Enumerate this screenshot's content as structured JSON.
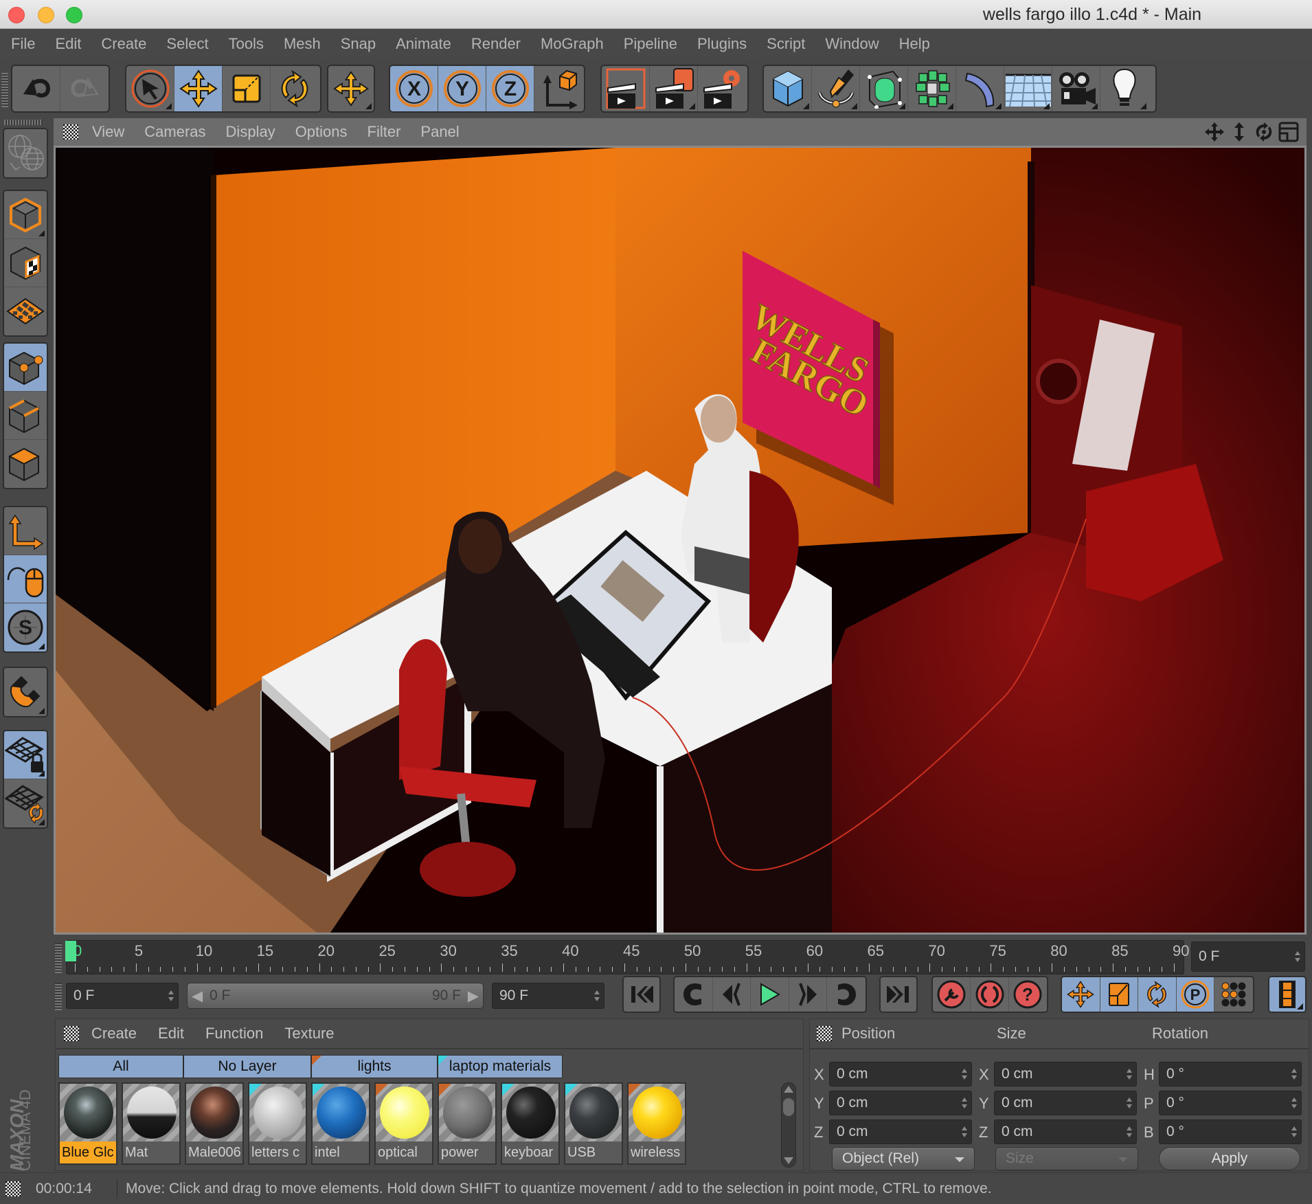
{
  "window": {
    "title": "wells fargo illo 1.c4d * - Main",
    "buttons": [
      "close",
      "minimize",
      "maximize"
    ]
  },
  "menubar": [
    "File",
    "Edit",
    "Create",
    "Select",
    "Tools",
    "Mesh",
    "Snap",
    "Animate",
    "Render",
    "MoGraph",
    "Pipeline",
    "Plugins",
    "Script",
    "Window",
    "Help"
  ],
  "toolbar": {
    "groups": [
      {
        "name": "history",
        "items": [
          {
            "icon": "undo-icon",
            "active": false
          },
          {
            "icon": "redo-icon",
            "active": false,
            "disabled": true
          }
        ]
      },
      {
        "name": "transform-tools",
        "items": [
          {
            "icon": "live-selection-icon",
            "active": false
          },
          {
            "icon": "move-icon",
            "active": true
          },
          {
            "icon": "scale-icon",
            "active": false
          },
          {
            "icon": "rotate-icon",
            "active": false
          }
        ]
      },
      {
        "name": "recent-tool",
        "items": [
          {
            "icon": "move-icon",
            "active": false
          }
        ]
      },
      {
        "name": "axis-lock",
        "items": [
          {
            "icon": "x-axis-icon",
            "label": "X",
            "active": true
          },
          {
            "icon": "y-axis-icon",
            "label": "Y",
            "active": true
          },
          {
            "icon": "z-axis-icon",
            "label": "Z",
            "active": true
          },
          {
            "icon": "coordinate-system-icon",
            "active": false
          }
        ]
      },
      {
        "name": "render",
        "items": [
          {
            "icon": "render-view-icon"
          },
          {
            "icon": "render-to-picture-viewer-icon"
          },
          {
            "icon": "render-settings-icon"
          }
        ]
      },
      {
        "name": "objects",
        "items": [
          {
            "icon": "cube-icon"
          },
          {
            "icon": "pen-spline-icon"
          },
          {
            "icon": "subdivision-surface-icon"
          },
          {
            "icon": "cloner-icon"
          },
          {
            "icon": "bend-deformer-icon"
          },
          {
            "icon": "floor-icon"
          },
          {
            "icon": "camera-icon"
          },
          {
            "icon": "light-icon"
          }
        ]
      }
    ]
  },
  "left_palette": [
    {
      "icon": "make-editable-icon",
      "active": false
    },
    {
      "icon": "model-mode-icon",
      "active": false
    },
    {
      "icon": "texture-mode-icon",
      "active": false
    },
    {
      "icon": "workplane-mode-icon",
      "active": false
    },
    {
      "icon": "points-mode-icon",
      "active": true
    },
    {
      "icon": "edges-mode-icon",
      "active": false
    },
    {
      "icon": "polygons-mode-icon",
      "active": false
    },
    {
      "icon": "axis-mode-icon",
      "active": false
    },
    {
      "icon": "tweak-mode-icon",
      "active": true
    },
    {
      "icon": "solo-mode-icon",
      "active": true
    },
    {
      "icon": "snapping-icon",
      "active": false
    },
    {
      "icon": "lock-workplane-icon",
      "active": true
    },
    {
      "icon": "align-workplane-icon",
      "active": false
    }
  ],
  "viewport": {
    "menu": [
      "View",
      "Cameras",
      "Display",
      "Options",
      "Filter",
      "Panel"
    ],
    "nav_icons": [
      "pan-icon",
      "zoom-icon",
      "orbit-icon",
      "toggle-layout-icon"
    ],
    "scene": {
      "sign_line1": "WELLS",
      "sign_line2": "FARGO",
      "colors": {
        "wall": "#e8700e",
        "sign": "#d81b57",
        "sign_text": "#e7b429",
        "floor": "#b77a4c",
        "desk": "#f2f2f2",
        "chair": "#b01818"
      }
    }
  },
  "timeline": {
    "labels": [
      "0",
      "5",
      "10",
      "15",
      "20",
      "25",
      "30",
      "35",
      "40",
      "45",
      "50",
      "55",
      "60",
      "65",
      "70",
      "75",
      "80",
      "85",
      "90"
    ],
    "start": 0,
    "end": 90,
    "current_frame": 0,
    "current_frame_field": "0 F",
    "min_field": "0 F",
    "range_start": "0 F",
    "range_end": "90 F",
    "max_field": "90 F",
    "playhead_color": "#4fe08f"
  },
  "playback": {
    "groups": [
      {
        "items": [
          "go-to-start-icon"
        ]
      },
      {
        "items": [
          "go-to-previous-key-icon",
          "previous-frame-icon",
          "play-icon",
          "next-frame-icon",
          "go-to-next-key-icon"
        ]
      },
      {
        "items": [
          "go-to-end-icon"
        ]
      },
      {
        "items": [
          "record-keys-icon",
          "autokeying-icon",
          "keyframe-selection-icon"
        ]
      },
      {
        "items": [
          "key-position-icon",
          "key-scale-icon",
          "key-rotation-icon",
          "key-parameter-icon",
          "key-point-level-icon"
        ]
      },
      {
        "items": [
          "scheme-settings-icon"
        ]
      }
    ]
  },
  "material_manager": {
    "menu": [
      "Create",
      "Edit",
      "Function",
      "Texture"
    ],
    "layer_tabs": [
      {
        "label": "All",
        "flag": null
      },
      {
        "label": "No Layer",
        "flag": null
      },
      {
        "label": "lights",
        "flag": "#c8662a"
      },
      {
        "label": "laptop materials",
        "flag": "#3fd2e0"
      }
    ],
    "materials": [
      {
        "name": "Blue Glc",
        "selected": true,
        "flag": null,
        "ball": "radial-gradient(circle at 45% 35%, #b7c3c8 0%, #55605e 25%, #1e2422 70%, #101412 100%)"
      },
      {
        "name": "Mat",
        "selected": false,
        "flag": null,
        "ball": "linear-gradient(#e6e6e6 0%, #d4d4d4 50%, #1e1e1e 58%, #0e0e0e 100%)"
      },
      {
        "name": "Male006",
        "selected": false,
        "flag": null,
        "ball": "radial-gradient(circle at 45% 35%, #c58a72 0%, #6a3e2e 30%, #2a2222 60%, #141414 100%)"
      },
      {
        "name": "letters c",
        "selected": false,
        "flag": "#3fd2e0",
        "ball": "radial-gradient(circle at 40% 35%, #f2f2f2 0%, #c6c6c6 40%, #8a8a8a 100%)"
      },
      {
        "name": "intel",
        "selected": false,
        "flag": "#3fd2e0",
        "ball": "radial-gradient(circle at 40% 35%, #5aa6e6 0%, #1e6fc0 40%, #0a2f60 100%)"
      },
      {
        "name": "optical",
        "selected": false,
        "flag": "#c8662a",
        "ball": "radial-gradient(circle at 40% 38%, #ffffe0 0%, #fbfa7a 35%, #f0ec40 85%, #fffff0 100%)"
      },
      {
        "name": "power",
        "selected": false,
        "flag": "#c8662a",
        "ball": "radial-gradient(circle at 40% 35%, #9a9a9a 0%, #6e6e6e 50%, #2a2a2a 100%)"
      },
      {
        "name": "keyboar",
        "selected": false,
        "flag": "#3fd2e0",
        "ball": "radial-gradient(circle at 35% 35%, #6a6a6a 0%, #222 30%, #0a0a0a 100%)"
      },
      {
        "name": "USB",
        "selected": false,
        "flag": "#3fd2e0",
        "ball": "radial-gradient(circle at 35% 35%, #7a7e80 0%, #3a3e42 30%, #161818 100%)"
      },
      {
        "name": "wireless",
        "selected": false,
        "flag": "#c8662a",
        "ball": "radial-gradient(circle at 38% 38%, #fff6b0 0%, #ffd81a 30%, #e8a800 75%, #6a4a00 100%)"
      }
    ]
  },
  "coordinates": {
    "headers": [
      "Position",
      "Size",
      "Rotation"
    ],
    "rows": [
      {
        "pos_axis": "X",
        "pos": "0 cm",
        "size_axis": "X",
        "size": "0 cm",
        "rot_axis": "H",
        "rot": "0 °"
      },
      {
        "pos_axis": "Y",
        "pos": "0 cm",
        "size_axis": "Y",
        "size": "0 cm",
        "rot_axis": "P",
        "rot": "0 °"
      },
      {
        "pos_axis": "Z",
        "pos": "0 cm",
        "size_axis": "Z",
        "size": "0 cm",
        "rot_axis": "B",
        "rot": "0 °"
      }
    ],
    "mode_dropdown": "Object (Rel)",
    "size_dropdown": "Size",
    "apply_label": "Apply"
  },
  "brand": {
    "line1": "MAXON",
    "line2": "CINEMA 4D"
  },
  "statusbar": {
    "time": "00:00:14",
    "message": "Move: Click and drag to move elements. Hold down SHIFT to quantize movement / add to the selection in point mode, CTRL to remove."
  }
}
